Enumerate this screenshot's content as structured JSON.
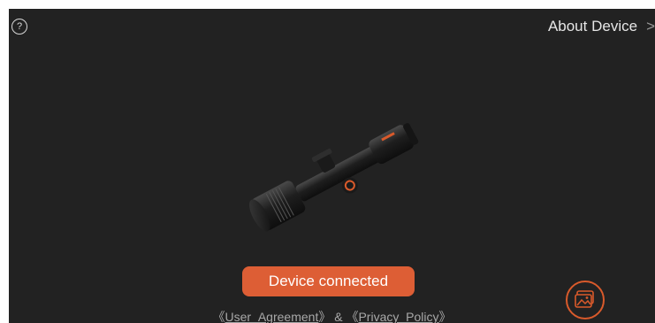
{
  "header": {
    "help_glyph": "?",
    "about_label": "About Device",
    "about_chevron": ">"
  },
  "status": {
    "connected_label": "Device connected"
  },
  "footer": {
    "left_bracket_1": "《",
    "user_agreement": "User_Agreement",
    "right_bracket_1": "》",
    "separator": " & ",
    "left_bracket_2": "《",
    "privacy_policy": "Privacy_Policy",
    "right_bracket_2": "》"
  },
  "colors": {
    "background": "#222222",
    "accent": "#dd5e35"
  },
  "icons": {
    "help": "question-circle-icon",
    "about": "chevron-right-icon",
    "gallery": "image-gallery-icon"
  }
}
